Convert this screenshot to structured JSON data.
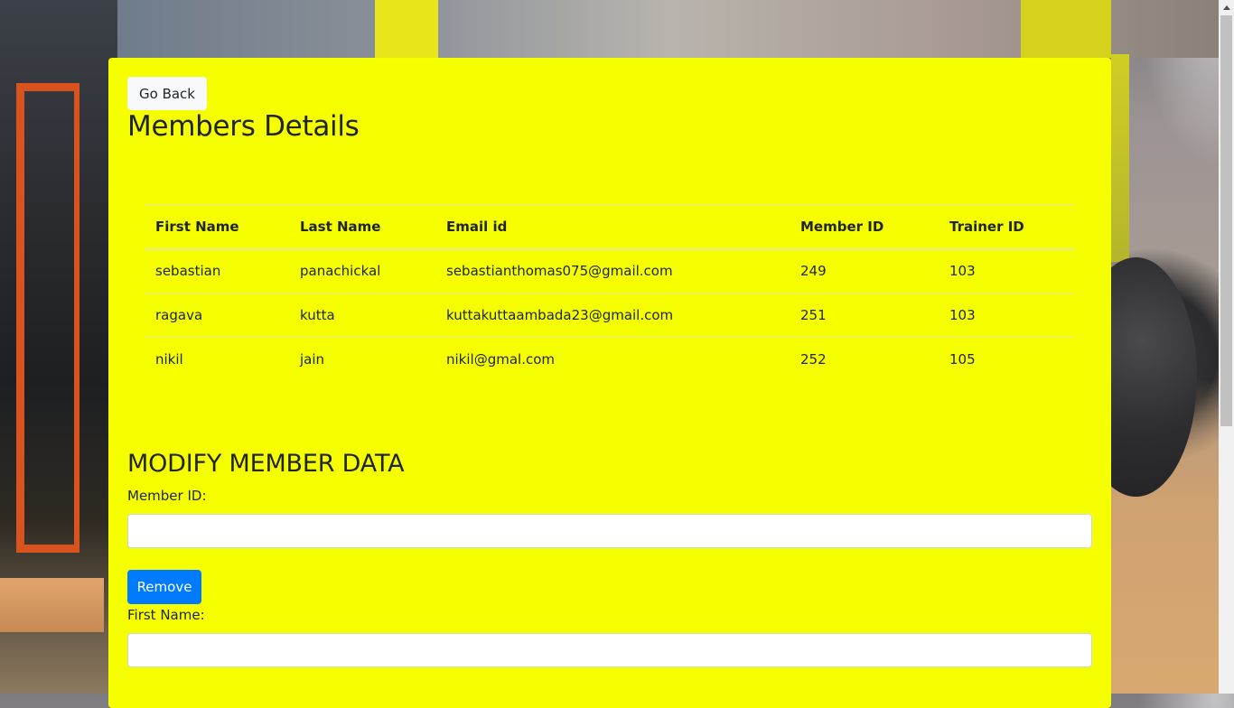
{
  "nav": {
    "go_back_label": "Go Back"
  },
  "page": {
    "title": "Members Details"
  },
  "table": {
    "headers": [
      "First Name",
      "Last Name",
      "Email id",
      "Member ID",
      "Trainer ID"
    ],
    "rows": [
      [
        "sebastian",
        "panachickal",
        "sebastianthomas075@gmail.com",
        "249",
        "103"
      ],
      [
        "ragava",
        "kutta",
        "kuttakuttaambada23@gmail.com",
        "251",
        "103"
      ],
      [
        "nikil",
        "jain",
        "nikil@gmal.com",
        "252",
        "105"
      ]
    ]
  },
  "modify": {
    "title": "MODIFY MEMBER DATA",
    "member_id_label": "Member ID:",
    "member_id_value": "",
    "remove_label": "Remove",
    "first_name_label": "First Name:",
    "first_name_value": ""
  },
  "colors": {
    "panel": "#f5ff00",
    "primary_button": "#007bff",
    "light_button": "#f8f9fa"
  }
}
